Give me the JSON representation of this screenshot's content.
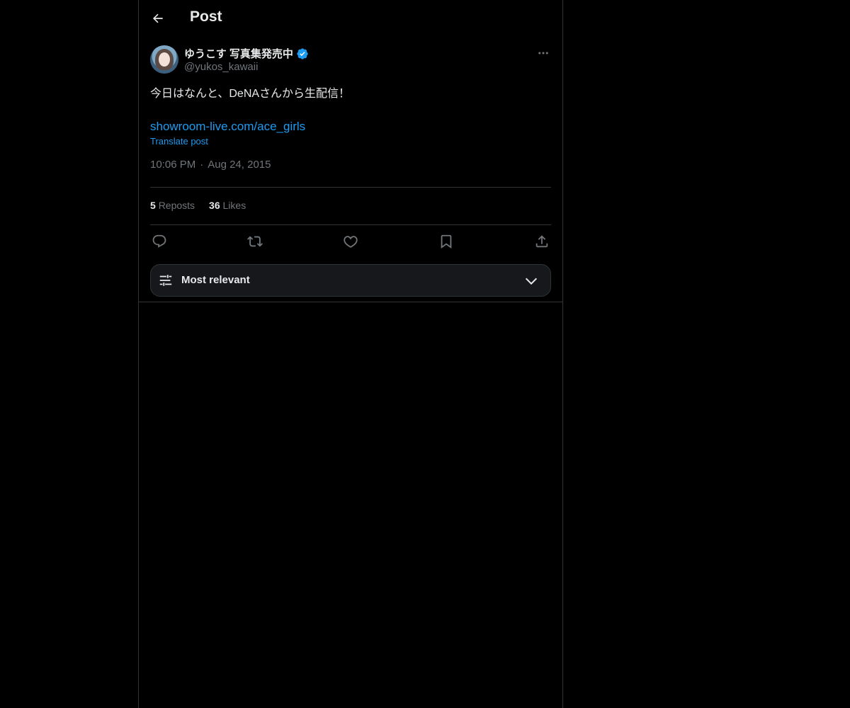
{
  "header": {
    "title": "Post",
    "back_icon": "arrow-left-icon"
  },
  "tweet": {
    "author": {
      "display_name": "ゆうこす 写真集発売中",
      "handle": "@yukos_kawaii",
      "verified": true,
      "verified_color": "#1d9bf0"
    },
    "text": "今日はなんと、DeNAさんから生配信！",
    "link": "showroom-live.com/ace_girls",
    "translate_label": "Translate post",
    "time": "10:06 PM",
    "separator": "·",
    "date": "Aug 24, 2015"
  },
  "stats": {
    "reposts_count": "5",
    "reposts_label": "Reposts",
    "likes_count": "36",
    "likes_label": "Likes"
  },
  "actions": [
    {
      "name": "reply",
      "icon": "reply-icon"
    },
    {
      "name": "repost",
      "icon": "repost-icon"
    },
    {
      "name": "like",
      "icon": "heart-icon"
    },
    {
      "name": "bookmark",
      "icon": "bookmark-icon"
    },
    {
      "name": "share",
      "icon": "share-icon"
    }
  ],
  "sort": {
    "label": "Most relevant",
    "icon": "sliders-icon",
    "chevron": "chevron-down-icon"
  },
  "colors": {
    "background": "#000000",
    "text": "#e7e9ea",
    "muted": "#71767b",
    "accent": "#1d9bf0",
    "border": "#2f3336"
  }
}
